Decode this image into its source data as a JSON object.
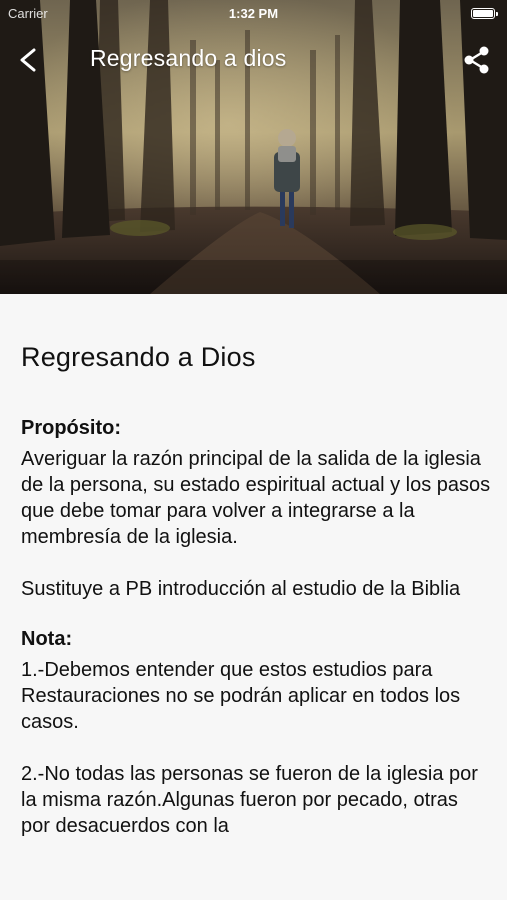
{
  "status_bar": {
    "carrier": "Carrier",
    "time": "1:32 PM"
  },
  "nav": {
    "title": "Regresando a dios",
    "back_icon": "chevron-left-icon",
    "share_icon": "share-icon"
  },
  "hero": {
    "description_icon": "forest-path-photo"
  },
  "article": {
    "title": "Regresando a Dios",
    "purpose_label": "Propósito:",
    "purpose_text": "Averiguar la razón principal de la salida de la iglesia de la persona, su estado espiritual actual y los pasos que debe tomar para volver a integrarse a la membresía de la iglesia.",
    "replaces_text": "Sustituye a PB introducción al estudio de la Biblia",
    "note_label": "Nota:",
    "note_1": "1.-Debemos entender que estos estudios para Restauraciones no se podrán aplicar en todos los casos.",
    "note_2": "2.-No todas las personas se fueron de la iglesia por la misma razón.Algunas fueron por pecado, otras por desacuerdos con la"
  },
  "colors": {
    "background": "#f7f7f7",
    "text": "#111111",
    "nav_text": "#ffffff"
  }
}
